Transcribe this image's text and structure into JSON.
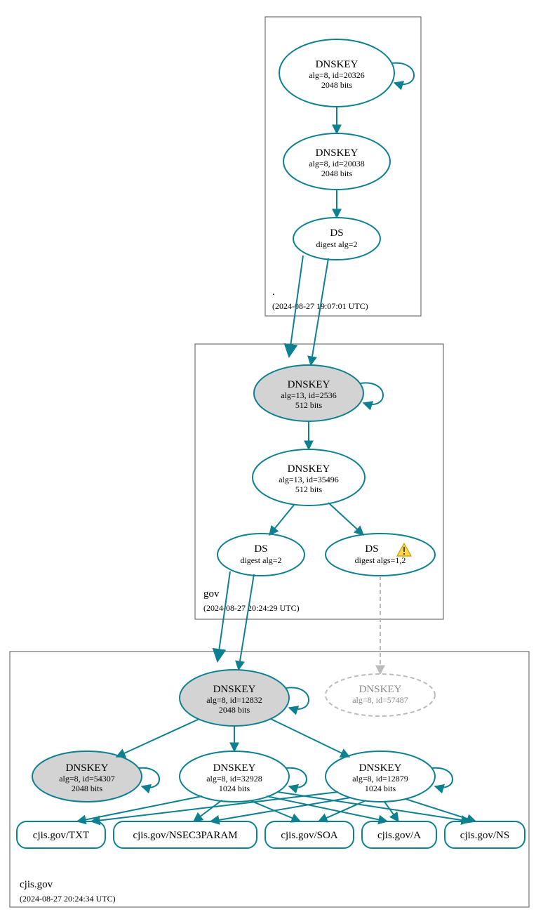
{
  "color": {
    "teal": "#0d8091",
    "grey": "#d3d3d3",
    "ghost": "#bbbbbb"
  },
  "zones": {
    "root": {
      "label": ".",
      "timestamp": "(2024-08-27 19:07:01 UTC)"
    },
    "gov": {
      "label": "gov",
      "timestamp": "(2024-08-27 20:24:29 UTC)"
    },
    "cjis": {
      "label": "cjis.gov",
      "timestamp": "(2024-08-27 20:24:34 UTC)"
    }
  },
  "nodes": {
    "root_ksk": {
      "title": "DNSKEY",
      "line2": "alg=8, id=20326",
      "line3": "2048 bits"
    },
    "root_zsk": {
      "title": "DNSKEY",
      "line2": "alg=8, id=20038",
      "line3": "2048 bits"
    },
    "root_ds": {
      "title": "DS",
      "line2": "digest alg=2"
    },
    "gov_ksk": {
      "title": "DNSKEY",
      "line2": "alg=13, id=2536",
      "line3": "512 bits"
    },
    "gov_zsk": {
      "title": "DNSKEY",
      "line2": "alg=13, id=35496",
      "line3": "512 bits"
    },
    "gov_ds1": {
      "title": "DS",
      "line2": "digest alg=2"
    },
    "gov_ds2": {
      "title": "DS",
      "line2": "digest algs=1,2"
    },
    "cjis_ksk": {
      "title": "DNSKEY",
      "line2": "alg=8, id=12832",
      "line3": "2048 bits"
    },
    "cjis_54307": {
      "title": "DNSKEY",
      "line2": "alg=8, id=54307",
      "line3": "2048 bits"
    },
    "cjis_32928": {
      "title": "DNSKEY",
      "line2": "alg=8, id=32928",
      "line3": "1024 bits"
    },
    "cjis_12879": {
      "title": "DNSKEY",
      "line2": "alg=8, id=12879",
      "line3": "1024 bits"
    },
    "cjis_ghost": {
      "title": "DNSKEY",
      "line2": "alg=8, id=57487"
    }
  },
  "rrsets": {
    "txt": "cjis.gov/TXT",
    "nsec3param": "cjis.gov/NSEC3PARAM",
    "soa": "cjis.gov/SOA",
    "a": "cjis.gov/A",
    "ns": "cjis.gov/NS"
  }
}
